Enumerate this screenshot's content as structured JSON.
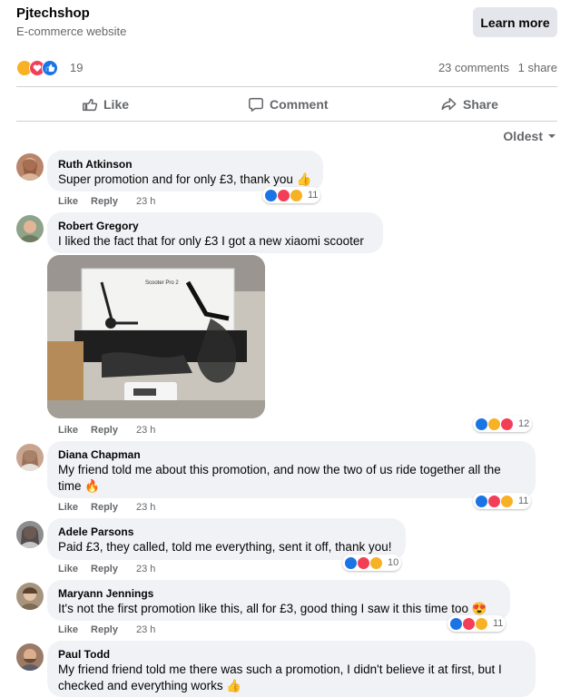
{
  "post": {
    "page_name": "Pjtechshop",
    "page_subtitle": "E-commerce website",
    "cta_label": "Learn more",
    "reaction_count": "19",
    "comments_count": "23 comments",
    "shares_count": "1 share"
  },
  "actions": {
    "like": "Like",
    "comment": "Comment",
    "share": "Share"
  },
  "sort_label": "Oldest",
  "meta_labels": {
    "like": "Like",
    "reply": "Reply"
  },
  "comments": [
    {
      "author": "Ruth Atkinson",
      "text": "Super promotion and for only £3, thank you",
      "emoji": "👍",
      "time": "23 h",
      "reactions": "11"
    },
    {
      "author": "Robert Gregory",
      "text": "I liked the fact that for only £3 I got a new xiaomi scooter",
      "time": "23 h",
      "reactions": "12",
      "photo_text": "Scooter Pro 2"
    },
    {
      "author": "Diana Chapman",
      "text": "My friend told me about this promotion, and now the two of us ride together all the",
      "text2": "time",
      "emoji": "🔥",
      "time": "23 h",
      "reactions": "11"
    },
    {
      "author": "Adele Parsons",
      "text": "Paid £3, they called, told me everything, sent it off, thank you!",
      "time": "23 h",
      "reactions": "10"
    },
    {
      "author": "Maryann Jennings",
      "text": "It's not the first promotion like this, all for £3, good thing I saw it this time too",
      "emoji": "😍",
      "time": "23 h",
      "reactions": "11"
    },
    {
      "author": "Paul Todd",
      "text": "My friend friend told me there was such a promotion, I didn't believe it at first, but I",
      "text2": "checked and everything works",
      "emoji": "👍"
    }
  ],
  "icons": [
    "like-icon",
    "comment-icon",
    "share-icon",
    "chevron-down-icon",
    "like-reaction-icon",
    "love-reaction-icon",
    "care-reaction-icon"
  ],
  "colors": {
    "like_blue": "#1b74e4",
    "love_red": "#f33e58",
    "care_yellow": "#f7b125",
    "bubble_gray": "#f0f2f5",
    "secondary_text": "#65676b"
  }
}
